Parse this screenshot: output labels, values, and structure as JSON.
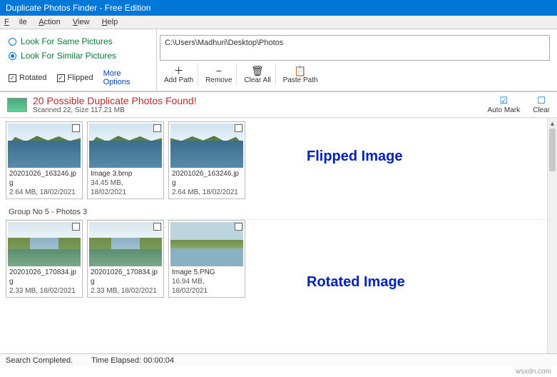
{
  "title": "Duplicate Photos Finder - Free Edition",
  "menu": {
    "file": "File",
    "action": "Action",
    "view": "View",
    "help": "Help"
  },
  "options": {
    "same": "Look For Same Pictures",
    "similar": "Look For Similar Pictures",
    "rotated": "Rotated",
    "flipped": "Flipped",
    "more": "More Options"
  },
  "path": "C:\\Users\\Madhuri\\Desktop\\Photos",
  "toolbar": {
    "add": "Add Path",
    "remove": "Remove",
    "clear": "Clear All",
    "paste": "Paste Path"
  },
  "result": {
    "title": "20 Possible Duplicate Photos Found!",
    "sub": "Scanned 22, Size 117.21 MB",
    "automark": "Auto Mark",
    "clearact": "Clear"
  },
  "group1": [
    {
      "fn": "20201026_163246.jpg",
      "meta": "2.64 MB, 18/02/2021"
    },
    {
      "fn": "Image 3.bmp",
      "meta": "34.45 MB, 18/02/2021"
    },
    {
      "fn": "20201026_163246.jpg",
      "meta": "2.64 MB, 18/02/2021"
    }
  ],
  "group_label": "Group No 5  -  Photos 3",
  "group2": [
    {
      "fn": "20201026_170834.jpg",
      "meta": "2.33 MB, 18/02/2021"
    },
    {
      "fn": "20201026_170834.jpg",
      "meta": "2.33 MB, 18/02/2021"
    },
    {
      "fn": "Image 5.PNG",
      "meta": "16.94 MB, 18/02/2021"
    }
  ],
  "annot": {
    "flipped": "Flipped Image",
    "rotated": "Rotated Image"
  },
  "status": {
    "done": "Search Completed.",
    "time_lbl": "Time Elapsed:",
    "time_val": "00:00:04"
  },
  "watermark": "wsxdn.com"
}
